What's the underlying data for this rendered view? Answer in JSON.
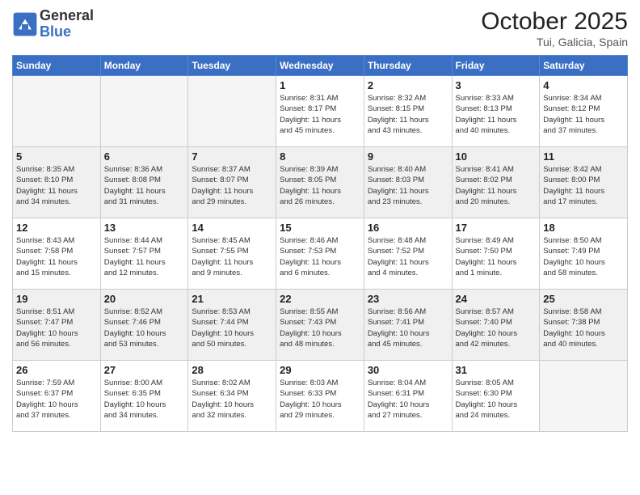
{
  "header": {
    "logo_general": "General",
    "logo_blue": "Blue",
    "month_year": "October 2025",
    "location": "Tui, Galicia, Spain"
  },
  "weekdays": [
    "Sunday",
    "Monday",
    "Tuesday",
    "Wednesday",
    "Thursday",
    "Friday",
    "Saturday"
  ],
  "weeks": [
    [
      {
        "day": "",
        "info": ""
      },
      {
        "day": "",
        "info": ""
      },
      {
        "day": "",
        "info": ""
      },
      {
        "day": "1",
        "info": "Sunrise: 8:31 AM\nSunset: 8:17 PM\nDaylight: 11 hours\nand 45 minutes."
      },
      {
        "day": "2",
        "info": "Sunrise: 8:32 AM\nSunset: 8:15 PM\nDaylight: 11 hours\nand 43 minutes."
      },
      {
        "day": "3",
        "info": "Sunrise: 8:33 AM\nSunset: 8:13 PM\nDaylight: 11 hours\nand 40 minutes."
      },
      {
        "day": "4",
        "info": "Sunrise: 8:34 AM\nSunset: 8:12 PM\nDaylight: 11 hours\nand 37 minutes."
      }
    ],
    [
      {
        "day": "5",
        "info": "Sunrise: 8:35 AM\nSunset: 8:10 PM\nDaylight: 11 hours\nand 34 minutes."
      },
      {
        "day": "6",
        "info": "Sunrise: 8:36 AM\nSunset: 8:08 PM\nDaylight: 11 hours\nand 31 minutes."
      },
      {
        "day": "7",
        "info": "Sunrise: 8:37 AM\nSunset: 8:07 PM\nDaylight: 11 hours\nand 29 minutes."
      },
      {
        "day": "8",
        "info": "Sunrise: 8:39 AM\nSunset: 8:05 PM\nDaylight: 11 hours\nand 26 minutes."
      },
      {
        "day": "9",
        "info": "Sunrise: 8:40 AM\nSunset: 8:03 PM\nDaylight: 11 hours\nand 23 minutes."
      },
      {
        "day": "10",
        "info": "Sunrise: 8:41 AM\nSunset: 8:02 PM\nDaylight: 11 hours\nand 20 minutes."
      },
      {
        "day": "11",
        "info": "Sunrise: 8:42 AM\nSunset: 8:00 PM\nDaylight: 11 hours\nand 17 minutes."
      }
    ],
    [
      {
        "day": "12",
        "info": "Sunrise: 8:43 AM\nSunset: 7:58 PM\nDaylight: 11 hours\nand 15 minutes."
      },
      {
        "day": "13",
        "info": "Sunrise: 8:44 AM\nSunset: 7:57 PM\nDaylight: 11 hours\nand 12 minutes."
      },
      {
        "day": "14",
        "info": "Sunrise: 8:45 AM\nSunset: 7:55 PM\nDaylight: 11 hours\nand 9 minutes."
      },
      {
        "day": "15",
        "info": "Sunrise: 8:46 AM\nSunset: 7:53 PM\nDaylight: 11 hours\nand 6 minutes."
      },
      {
        "day": "16",
        "info": "Sunrise: 8:48 AM\nSunset: 7:52 PM\nDaylight: 11 hours\nand 4 minutes."
      },
      {
        "day": "17",
        "info": "Sunrise: 8:49 AM\nSunset: 7:50 PM\nDaylight: 11 hours\nand 1 minute."
      },
      {
        "day": "18",
        "info": "Sunrise: 8:50 AM\nSunset: 7:49 PM\nDaylight: 10 hours\nand 58 minutes."
      }
    ],
    [
      {
        "day": "19",
        "info": "Sunrise: 8:51 AM\nSunset: 7:47 PM\nDaylight: 10 hours\nand 56 minutes."
      },
      {
        "day": "20",
        "info": "Sunrise: 8:52 AM\nSunset: 7:46 PM\nDaylight: 10 hours\nand 53 minutes."
      },
      {
        "day": "21",
        "info": "Sunrise: 8:53 AM\nSunset: 7:44 PM\nDaylight: 10 hours\nand 50 minutes."
      },
      {
        "day": "22",
        "info": "Sunrise: 8:55 AM\nSunset: 7:43 PM\nDaylight: 10 hours\nand 48 minutes."
      },
      {
        "day": "23",
        "info": "Sunrise: 8:56 AM\nSunset: 7:41 PM\nDaylight: 10 hours\nand 45 minutes."
      },
      {
        "day": "24",
        "info": "Sunrise: 8:57 AM\nSunset: 7:40 PM\nDaylight: 10 hours\nand 42 minutes."
      },
      {
        "day": "25",
        "info": "Sunrise: 8:58 AM\nSunset: 7:38 PM\nDaylight: 10 hours\nand 40 minutes."
      }
    ],
    [
      {
        "day": "26",
        "info": "Sunrise: 7:59 AM\nSunset: 6:37 PM\nDaylight: 10 hours\nand 37 minutes."
      },
      {
        "day": "27",
        "info": "Sunrise: 8:00 AM\nSunset: 6:35 PM\nDaylight: 10 hours\nand 34 minutes."
      },
      {
        "day": "28",
        "info": "Sunrise: 8:02 AM\nSunset: 6:34 PM\nDaylight: 10 hours\nand 32 minutes."
      },
      {
        "day": "29",
        "info": "Sunrise: 8:03 AM\nSunset: 6:33 PM\nDaylight: 10 hours\nand 29 minutes."
      },
      {
        "day": "30",
        "info": "Sunrise: 8:04 AM\nSunset: 6:31 PM\nDaylight: 10 hours\nand 27 minutes."
      },
      {
        "day": "31",
        "info": "Sunrise: 8:05 AM\nSunset: 6:30 PM\nDaylight: 10 hours\nand 24 minutes."
      },
      {
        "day": "",
        "info": ""
      }
    ]
  ]
}
